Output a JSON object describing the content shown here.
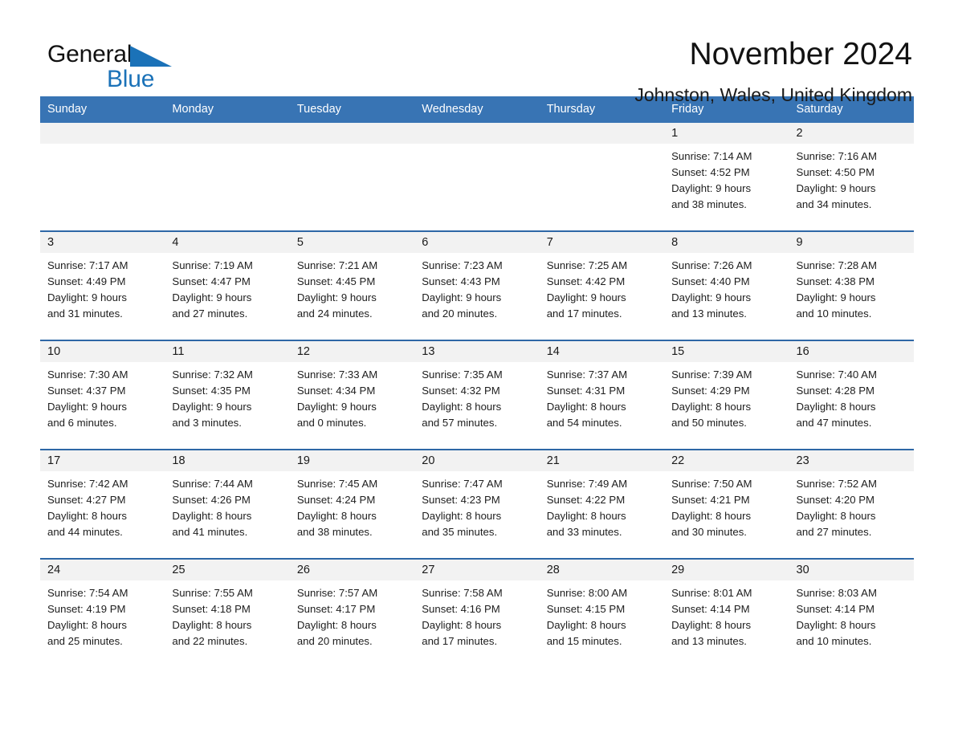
{
  "brand": {
    "name_part1": "General",
    "name_part2": "Blue",
    "accent_color": "#1b72b8"
  },
  "header": {
    "title": "November 2024",
    "subtitle": "Johnston, Wales, United Kingdom"
  },
  "calendar": {
    "header_bg": "#3874b4",
    "daynum_bg": "#f2f2f2",
    "weekdays": [
      "Sunday",
      "Monday",
      "Tuesday",
      "Wednesday",
      "Thursday",
      "Friday",
      "Saturday"
    ],
    "weeks": [
      [
        {
          "day": ""
        },
        {
          "day": ""
        },
        {
          "day": ""
        },
        {
          "day": ""
        },
        {
          "day": ""
        },
        {
          "day": "1",
          "sunrise": "Sunrise: 7:14 AM",
          "sunset": "Sunset: 4:52 PM",
          "daylight_line1": "Daylight: 9 hours",
          "daylight_line2": "and 38 minutes."
        },
        {
          "day": "2",
          "sunrise": "Sunrise: 7:16 AM",
          "sunset": "Sunset: 4:50 PM",
          "daylight_line1": "Daylight: 9 hours",
          "daylight_line2": "and 34 minutes."
        }
      ],
      [
        {
          "day": "3",
          "sunrise": "Sunrise: 7:17 AM",
          "sunset": "Sunset: 4:49 PM",
          "daylight_line1": "Daylight: 9 hours",
          "daylight_line2": "and 31 minutes."
        },
        {
          "day": "4",
          "sunrise": "Sunrise: 7:19 AM",
          "sunset": "Sunset: 4:47 PM",
          "daylight_line1": "Daylight: 9 hours",
          "daylight_line2": "and 27 minutes."
        },
        {
          "day": "5",
          "sunrise": "Sunrise: 7:21 AM",
          "sunset": "Sunset: 4:45 PM",
          "daylight_line1": "Daylight: 9 hours",
          "daylight_line2": "and 24 minutes."
        },
        {
          "day": "6",
          "sunrise": "Sunrise: 7:23 AM",
          "sunset": "Sunset: 4:43 PM",
          "daylight_line1": "Daylight: 9 hours",
          "daylight_line2": "and 20 minutes."
        },
        {
          "day": "7",
          "sunrise": "Sunrise: 7:25 AM",
          "sunset": "Sunset: 4:42 PM",
          "daylight_line1": "Daylight: 9 hours",
          "daylight_line2": "and 17 minutes."
        },
        {
          "day": "8",
          "sunrise": "Sunrise: 7:26 AM",
          "sunset": "Sunset: 4:40 PM",
          "daylight_line1": "Daylight: 9 hours",
          "daylight_line2": "and 13 minutes."
        },
        {
          "day": "9",
          "sunrise": "Sunrise: 7:28 AM",
          "sunset": "Sunset: 4:38 PM",
          "daylight_line1": "Daylight: 9 hours",
          "daylight_line2": "and 10 minutes."
        }
      ],
      [
        {
          "day": "10",
          "sunrise": "Sunrise: 7:30 AM",
          "sunset": "Sunset: 4:37 PM",
          "daylight_line1": "Daylight: 9 hours",
          "daylight_line2": "and 6 minutes."
        },
        {
          "day": "11",
          "sunrise": "Sunrise: 7:32 AM",
          "sunset": "Sunset: 4:35 PM",
          "daylight_line1": "Daylight: 9 hours",
          "daylight_line2": "and 3 minutes."
        },
        {
          "day": "12",
          "sunrise": "Sunrise: 7:33 AM",
          "sunset": "Sunset: 4:34 PM",
          "daylight_line1": "Daylight: 9 hours",
          "daylight_line2": "and 0 minutes."
        },
        {
          "day": "13",
          "sunrise": "Sunrise: 7:35 AM",
          "sunset": "Sunset: 4:32 PM",
          "daylight_line1": "Daylight: 8 hours",
          "daylight_line2": "and 57 minutes."
        },
        {
          "day": "14",
          "sunrise": "Sunrise: 7:37 AM",
          "sunset": "Sunset: 4:31 PM",
          "daylight_line1": "Daylight: 8 hours",
          "daylight_line2": "and 54 minutes."
        },
        {
          "day": "15",
          "sunrise": "Sunrise: 7:39 AM",
          "sunset": "Sunset: 4:29 PM",
          "daylight_line1": "Daylight: 8 hours",
          "daylight_line2": "and 50 minutes."
        },
        {
          "day": "16",
          "sunrise": "Sunrise: 7:40 AM",
          "sunset": "Sunset: 4:28 PM",
          "daylight_line1": "Daylight: 8 hours",
          "daylight_line2": "and 47 minutes."
        }
      ],
      [
        {
          "day": "17",
          "sunrise": "Sunrise: 7:42 AM",
          "sunset": "Sunset: 4:27 PM",
          "daylight_line1": "Daylight: 8 hours",
          "daylight_line2": "and 44 minutes."
        },
        {
          "day": "18",
          "sunrise": "Sunrise: 7:44 AM",
          "sunset": "Sunset: 4:26 PM",
          "daylight_line1": "Daylight: 8 hours",
          "daylight_line2": "and 41 minutes."
        },
        {
          "day": "19",
          "sunrise": "Sunrise: 7:45 AM",
          "sunset": "Sunset: 4:24 PM",
          "daylight_line1": "Daylight: 8 hours",
          "daylight_line2": "and 38 minutes."
        },
        {
          "day": "20",
          "sunrise": "Sunrise: 7:47 AM",
          "sunset": "Sunset: 4:23 PM",
          "daylight_line1": "Daylight: 8 hours",
          "daylight_line2": "and 35 minutes."
        },
        {
          "day": "21",
          "sunrise": "Sunrise: 7:49 AM",
          "sunset": "Sunset: 4:22 PM",
          "daylight_line1": "Daylight: 8 hours",
          "daylight_line2": "and 33 minutes."
        },
        {
          "day": "22",
          "sunrise": "Sunrise: 7:50 AM",
          "sunset": "Sunset: 4:21 PM",
          "daylight_line1": "Daylight: 8 hours",
          "daylight_line2": "and 30 minutes."
        },
        {
          "day": "23",
          "sunrise": "Sunrise: 7:52 AM",
          "sunset": "Sunset: 4:20 PM",
          "daylight_line1": "Daylight: 8 hours",
          "daylight_line2": "and 27 minutes."
        }
      ],
      [
        {
          "day": "24",
          "sunrise": "Sunrise: 7:54 AM",
          "sunset": "Sunset: 4:19 PM",
          "daylight_line1": "Daylight: 8 hours",
          "daylight_line2": "and 25 minutes."
        },
        {
          "day": "25",
          "sunrise": "Sunrise: 7:55 AM",
          "sunset": "Sunset: 4:18 PM",
          "daylight_line1": "Daylight: 8 hours",
          "daylight_line2": "and 22 minutes."
        },
        {
          "day": "26",
          "sunrise": "Sunrise: 7:57 AM",
          "sunset": "Sunset: 4:17 PM",
          "daylight_line1": "Daylight: 8 hours",
          "daylight_line2": "and 20 minutes."
        },
        {
          "day": "27",
          "sunrise": "Sunrise: 7:58 AM",
          "sunset": "Sunset: 4:16 PM",
          "daylight_line1": "Daylight: 8 hours",
          "daylight_line2": "and 17 minutes."
        },
        {
          "day": "28",
          "sunrise": "Sunrise: 8:00 AM",
          "sunset": "Sunset: 4:15 PM",
          "daylight_line1": "Daylight: 8 hours",
          "daylight_line2": "and 15 minutes."
        },
        {
          "day": "29",
          "sunrise": "Sunrise: 8:01 AM",
          "sunset": "Sunset: 4:14 PM",
          "daylight_line1": "Daylight: 8 hours",
          "daylight_line2": "and 13 minutes."
        },
        {
          "day": "30",
          "sunrise": "Sunrise: 8:03 AM",
          "sunset": "Sunset: 4:14 PM",
          "daylight_line1": "Daylight: 8 hours",
          "daylight_line2": "and 10 minutes."
        }
      ]
    ]
  }
}
